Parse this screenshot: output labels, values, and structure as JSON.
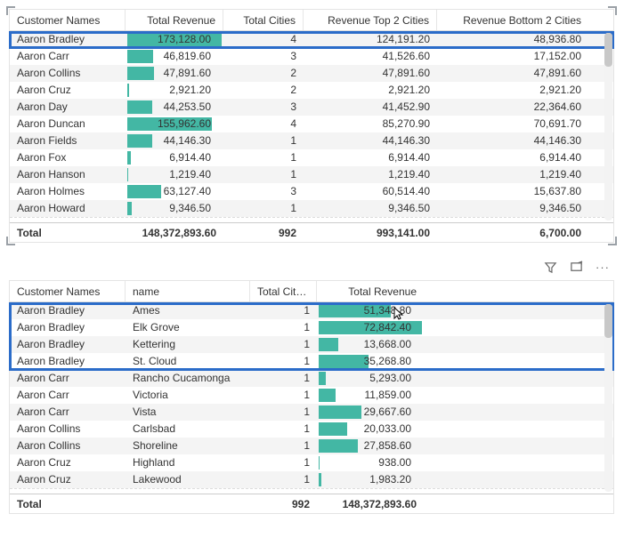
{
  "table1": {
    "headers": {
      "customer": "Customer Names",
      "revenue": "Total Revenue",
      "cities": "Total Cities",
      "top2": "Revenue Top 2 Cities",
      "bot2": "Revenue Bottom 2 Cities"
    },
    "rows": [
      {
        "customer": "Aaron Bradley",
        "revenue": "173,128.00",
        "revenue_bar": 1.0,
        "cities": "4",
        "top2": "124,191.20",
        "bot2": "48,936.80"
      },
      {
        "customer": "Aaron Carr",
        "revenue": "46,819.60",
        "revenue_bar": 0.27,
        "cities": "3",
        "top2": "41,526.60",
        "bot2": "17,152.00"
      },
      {
        "customer": "Aaron Collins",
        "revenue": "47,891.60",
        "revenue_bar": 0.28,
        "cities": "2",
        "top2": "47,891.60",
        "bot2": "47,891.60"
      },
      {
        "customer": "Aaron Cruz",
        "revenue": "2,921.20",
        "revenue_bar": 0.02,
        "cities": "2",
        "top2": "2,921.20",
        "bot2": "2,921.20"
      },
      {
        "customer": "Aaron Day",
        "revenue": "44,253.50",
        "revenue_bar": 0.26,
        "cities": "3",
        "top2": "41,452.90",
        "bot2": "22,364.60"
      },
      {
        "customer": "Aaron Duncan",
        "revenue": "155,962.60",
        "revenue_bar": 0.9,
        "cities": "4",
        "top2": "85,270.90",
        "bot2": "70,691.70"
      },
      {
        "customer": "Aaron Fields",
        "revenue": "44,146.30",
        "revenue_bar": 0.26,
        "cities": "1",
        "top2": "44,146.30",
        "bot2": "44,146.30"
      },
      {
        "customer": "Aaron Fox",
        "revenue": "6,914.40",
        "revenue_bar": 0.04,
        "cities": "1",
        "top2": "6,914.40",
        "bot2": "6,914.40"
      },
      {
        "customer": "Aaron Hanson",
        "revenue": "1,219.40",
        "revenue_bar": 0.01,
        "cities": "1",
        "top2": "1,219.40",
        "bot2": "1,219.40"
      },
      {
        "customer": "Aaron Holmes",
        "revenue": "63,127.40",
        "revenue_bar": 0.36,
        "cities": "3",
        "top2": "60,514.40",
        "bot2": "15,637.80"
      },
      {
        "customer": "Aaron Howard",
        "revenue": "9,346.50",
        "revenue_bar": 0.05,
        "cities": "1",
        "top2": "9,346.50",
        "bot2": "9,346.50"
      }
    ],
    "total": {
      "label": "Total",
      "revenue": "148,372,893.60",
      "cities": "992",
      "top2": "993,141.00",
      "bot2": "6,700.00"
    }
  },
  "table2": {
    "headers": {
      "customer": "Customer Names",
      "name": "name",
      "cities": "Total Cities",
      "revenue": "Total Revenue"
    },
    "rows": [
      {
        "customer": "Aaron Bradley",
        "name": "Ames",
        "cities": "1",
        "revenue": "51,348.80",
        "revenue_bar": 0.7,
        "hl": true
      },
      {
        "customer": "Aaron Bradley",
        "name": "Elk Grove",
        "cities": "1",
        "revenue": "72,842.40",
        "revenue_bar": 1.0,
        "hl": true
      },
      {
        "customer": "Aaron Bradley",
        "name": "Kettering",
        "cities": "1",
        "revenue": "13,668.00",
        "revenue_bar": 0.19,
        "hl": true
      },
      {
        "customer": "Aaron Bradley",
        "name": "St. Cloud",
        "cities": "1",
        "revenue": "35,268.80",
        "revenue_bar": 0.48,
        "hl": true
      },
      {
        "customer": "Aaron Carr",
        "name": "Rancho Cucamonga",
        "cities": "1",
        "revenue": "5,293.00",
        "revenue_bar": 0.07
      },
      {
        "customer": "Aaron Carr",
        "name": "Victoria",
        "cities": "1",
        "revenue": "11,859.00",
        "revenue_bar": 0.16
      },
      {
        "customer": "Aaron Carr",
        "name": "Vista",
        "cities": "1",
        "revenue": "29,667.60",
        "revenue_bar": 0.41
      },
      {
        "customer": "Aaron Collins",
        "name": "Carlsbad",
        "cities": "1",
        "revenue": "20,033.00",
        "revenue_bar": 0.28
      },
      {
        "customer": "Aaron Collins",
        "name": "Shoreline",
        "cities": "1",
        "revenue": "27,858.60",
        "revenue_bar": 0.38
      },
      {
        "customer": "Aaron Cruz",
        "name": "Highland",
        "cities": "1",
        "revenue": "938.00",
        "revenue_bar": 0.01
      },
      {
        "customer": "Aaron Cruz",
        "name": "Lakewood",
        "cities": "1",
        "revenue": "1,983.20",
        "revenue_bar": 0.03
      }
    ],
    "total": {
      "label": "Total",
      "cities": "992",
      "revenue": "148,372,893.60"
    }
  },
  "icons": {
    "filter": "filter-icon",
    "focus": "focus-mode-icon",
    "more": "more-icon"
  }
}
